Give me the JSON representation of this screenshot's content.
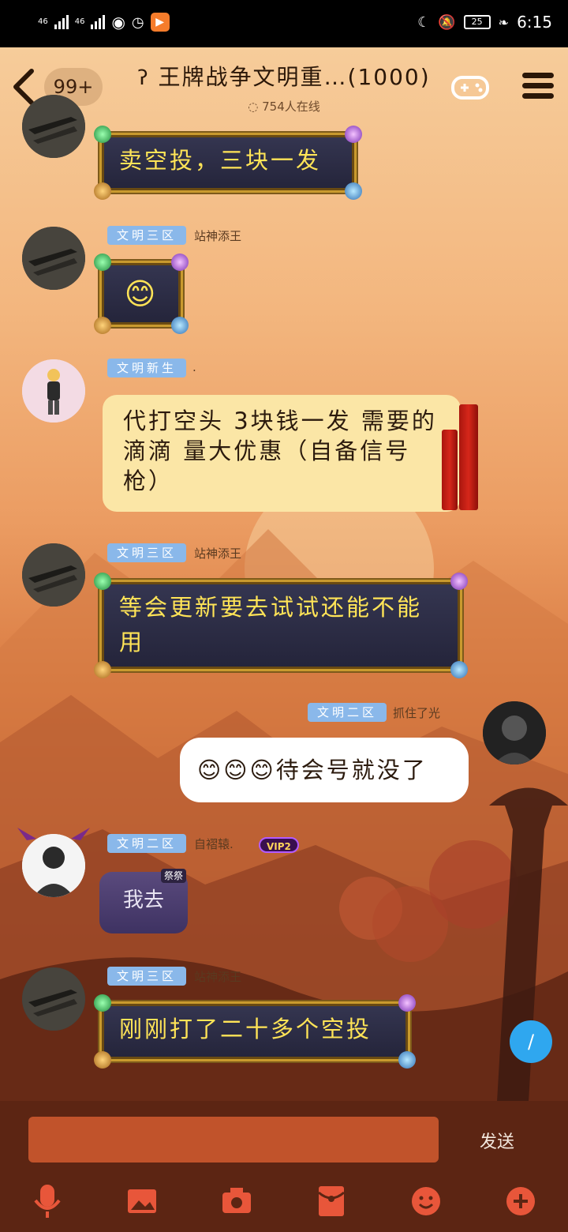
{
  "status_bar": {
    "signal_1": "46",
    "signal_2": "46",
    "app_badge": "▶",
    "battery": "25",
    "time": "6:15"
  },
  "header": {
    "back_icon": "chevron-left-icon",
    "unread_count": "99+",
    "title": "王牌战争文明重…(1000)",
    "online": "754人在线",
    "game_icon": "gamepad-icon",
    "menu_icon": "menu-icon"
  },
  "messages": [
    {
      "text": "卖空投，三块一发"
    },
    {
      "tag": "文明三区",
      "nick": "站神添王",
      "text": "😊"
    },
    {
      "tag": "文明新生",
      "nick": ".",
      "text": "代打空头 3块钱一发 需要的滴滴 量大优惠（自备信号枪）"
    },
    {
      "tag": "文明三区",
      "nick": "站神添王",
      "text": "等会更新要去试试还能不能用"
    },
    {
      "tag": "文明二区",
      "nick": "抓住了光",
      "text": "😊😊😊待会号就没了"
    },
    {
      "tag": "文明二区",
      "nick": "自褶辕.",
      "vip": "VIP2",
      "sticker": "我去",
      "sticker_badge": "祭祭"
    },
    {
      "tag": "文明三区",
      "nick": "站神添王",
      "text": "刚刚打了二十多个空投"
    }
  ],
  "fab": "/",
  "input": {
    "placeholder": "",
    "send_label": "发送"
  },
  "toolbar_icons": [
    "microphone-icon",
    "image-icon",
    "camera-icon",
    "red-packet-icon",
    "emoji-icon",
    "plus-icon"
  ]
}
